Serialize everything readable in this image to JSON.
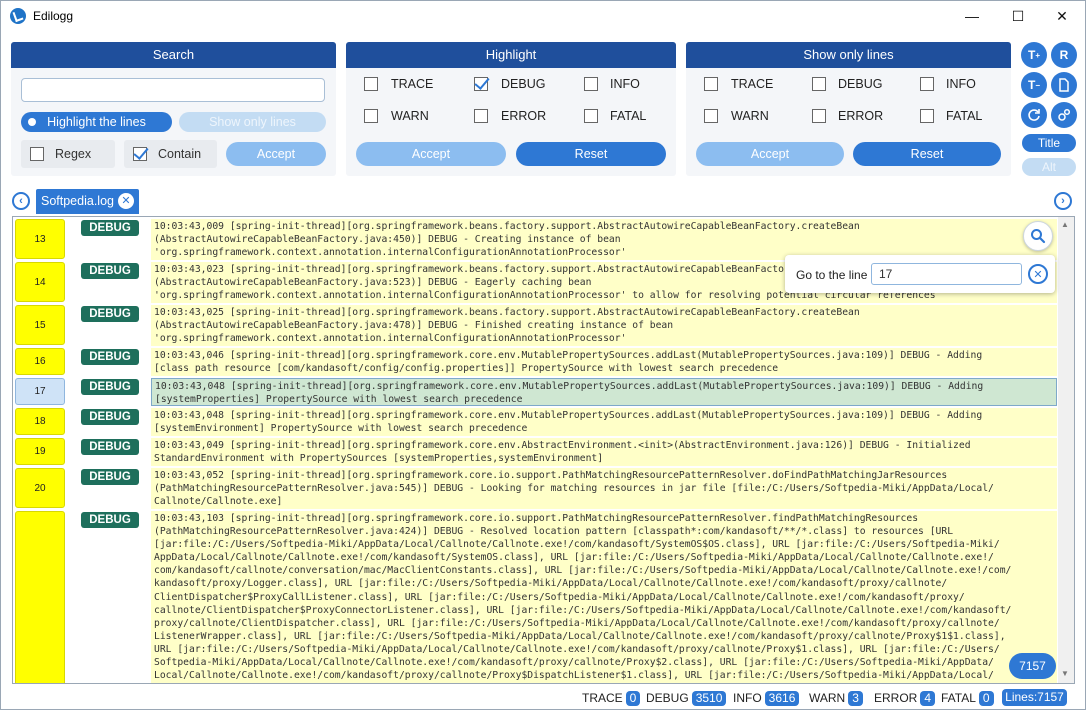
{
  "window": {
    "title": "Edilogg",
    "minimize_glyph": "—",
    "maximize_glyph": "☐",
    "close_glyph": "✕"
  },
  "search": {
    "header": "Search",
    "query": "",
    "highlight_label": "Highlight the lines",
    "show_only_label": "Show only lines",
    "regex_label": "Regex",
    "regex_checked": false,
    "contain_label": "Contain",
    "contain_checked": true,
    "accept_label": "Accept"
  },
  "highlight": {
    "header": "Highlight",
    "levels": [
      {
        "label": "TRACE",
        "checked": false
      },
      {
        "label": "DEBUG",
        "checked": true
      },
      {
        "label": "INFO",
        "checked": false
      },
      {
        "label": "WARN",
        "checked": false
      },
      {
        "label": "ERROR",
        "checked": false
      },
      {
        "label": "FATAL",
        "checked": false
      }
    ],
    "accept_label": "Accept",
    "reset_label": "Reset"
  },
  "show_only": {
    "header": "Show only lines",
    "levels": [
      {
        "label": "TRACE",
        "checked": false
      },
      {
        "label": "DEBUG",
        "checked": false
      },
      {
        "label": "INFO",
        "checked": false
      },
      {
        "label": "WARN",
        "checked": false
      },
      {
        "label": "ERROR",
        "checked": false
      },
      {
        "label": "FATAL",
        "checked": false
      }
    ],
    "accept_label": "Accept",
    "reset_label": "Reset"
  },
  "tools": {
    "r_label": "R",
    "title_label": "Title",
    "alt_label": "Alt"
  },
  "tabs": [
    {
      "label": "Softpedia.log",
      "active": true
    }
  ],
  "goto": {
    "label": "Go to the line",
    "value": "17"
  },
  "log_rows": [
    {
      "line": "13",
      "level": "DEBUG",
      "message": "10:03:43,009 [spring-init-thread][org.springframework.beans.factory.support.AbstractAutowireCapableBeanFactory.createBean\n(AbstractAutowireCapableBeanFactory.java:450)] DEBUG - Creating instance of bean\n'org.springframework.context.annotation.internalConfigurationAnnotationProcessor'"
    },
    {
      "line": "14",
      "level": "DEBUG",
      "message": "10:03:43,023 [spring-init-thread][org.springframework.beans.factory.support.AbstractAutowireCapableBeanFactory.createBean\n(AbstractAutowireCapableBeanFactory.java:523)] DEBUG - Eagerly caching bean\n'org.springframework.context.annotation.internalConfigurationAnnotationProcessor' to allow for resolving potential circular references"
    },
    {
      "line": "15",
      "level": "DEBUG",
      "message": "10:03:43,025 [spring-init-thread][org.springframework.beans.factory.support.AbstractAutowireCapableBeanFactory.createBean\n(AbstractAutowireCapableBeanFactory.java:478)] DEBUG - Finished creating instance of bean\n'org.springframework.context.annotation.internalConfigurationAnnotationProcessor'"
    },
    {
      "line": "16",
      "level": "DEBUG",
      "message": "10:03:43,046 [spring-init-thread][org.springframework.core.env.MutablePropertySources.addLast(MutablePropertySources.java:109)] DEBUG - Adding\n[class path resource [com/kandasoft/config/config.properties]] PropertySource with lowest search precedence"
    },
    {
      "line": "17",
      "level": "DEBUG",
      "message": "10:03:43,048 [spring-init-thread][org.springframework.core.env.MutablePropertySources.addLast(MutablePropertySources.java:109)] DEBUG - Adding\n[systemProperties] PropertySource with lowest search precedence"
    },
    {
      "line": "18",
      "level": "DEBUG",
      "message": "10:03:43,048 [spring-init-thread][org.springframework.core.env.MutablePropertySources.addLast(MutablePropertySources.java:109)] DEBUG - Adding\n[systemEnvironment] PropertySource with lowest search precedence"
    },
    {
      "line": "19",
      "level": "DEBUG",
      "message": "10:03:43,049 [spring-init-thread][org.springframework.core.env.AbstractEnvironment.<init>(AbstractEnvironment.java:126)] DEBUG - Initialized\nStandardEnvironment with PropertySources [systemProperties,systemEnvironment]"
    },
    {
      "line": "20",
      "level": "DEBUG",
      "message": "10:03:43,052 [spring-init-thread][org.springframework.core.io.support.PathMatchingResourcePatternResolver.doFindPathMatchingJarResources\n(PathMatchingResourcePatternResolver.java:545)] DEBUG - Looking for matching resources in jar file [file:/C:/Users/Softpedia-Miki/AppData/Local/\nCallnote/Callnote.exe]"
    },
    {
      "line": "",
      "level": "DEBUG",
      "message": "10:03:43,103 [spring-init-thread][org.springframework.core.io.support.PathMatchingResourcePatternResolver.findPathMatchingResources\n(PathMatchingResourcePatternResolver.java:424)] DEBUG - Resolved location pattern [classpath*:com/kandasoft/**/*.class] to resources [URL\n[jar:file:/C:/Users/Softpedia-Miki/AppData/Local/Callnote/Callnote.exe!/com/kandasoft/SystemOS$OS.class], URL [jar:file:/C:/Users/Softpedia-Miki/\nAppData/Local/Callnote/Callnote.exe!/com/kandasoft/SystemOS.class], URL [jar:file:/C:/Users/Softpedia-Miki/AppData/Local/Callnote/Callnote.exe!/\ncom/kandasoft/callnote/conversation/mac/MacClientConstants.class], URL [jar:file:/C:/Users/Softpedia-Miki/AppData/Local/Callnote/Callnote.exe!/com/\nkandasoft/proxy/Logger.class], URL [jar:file:/C:/Users/Softpedia-Miki/AppData/Local/Callnote/Callnote.exe!/com/kandasoft/proxy/callnote/\nClientDispatcher$ProxyCallListener.class], URL [jar:file:/C:/Users/Softpedia-Miki/AppData/Local/Callnote/Callnote.exe!/com/kandasoft/proxy/\ncallnote/ClientDispatcher$ProxyConnectorListener.class], URL [jar:file:/C:/Users/Softpedia-Miki/AppData/Local/Callnote/Callnote.exe!/com/kandasoft/\nproxy/callnote/ClientDispatcher.class], URL [jar:file:/C:/Users/Softpedia-Miki/AppData/Local/Callnote/Callnote.exe!/com/kandasoft/proxy/callnote/\nListenerWrapper.class], URL [jar:file:/C:/Users/Softpedia-Miki/AppData/Local/Callnote/Callnote.exe!/com/kandasoft/proxy/callnote/Proxy$1$1.class],\nURL [jar:file:/C:/Users/Softpedia-Miki/AppData/Local/Callnote/Callnote.exe!/com/kandasoft/proxy/callnote/Proxy$1.class], URL [jar:file:/C:/Users/\nSoftpedia-Miki/AppData/Local/Callnote/Callnote.exe!/com/kandasoft/proxy/callnote/Proxy$2.class], URL [jar:file:/C:/Users/Softpedia-Miki/AppData/\nLocal/Callnote/Callnote.exe!/com/kandasoft/proxy/callnote/Proxy$DispatchListener$1.class], URL [jar:file:/C:/Users/Softpedia-Miki/AppData/Local/"
    }
  ],
  "selected_line": "17",
  "line_count_bubble": "7157",
  "status": {
    "trace_label": "TRACE",
    "trace_count": "0",
    "debug_label": "DEBUG",
    "debug_count": "3510",
    "info_label": "INFO",
    "info_count": "3616",
    "warn_label": "WARN",
    "warn_count": "3",
    "error_label": "ERROR",
    "error_count": "4",
    "fatal_label": "FATAL",
    "fatal_count": "0",
    "lines_label": "Lines:7157"
  },
  "colors": {
    "header_blue": "#1f4f9c",
    "accent_blue": "#2e78d4",
    "line_number_yellow": "#ffff00",
    "message_yellow": "#ffffc8",
    "debug_badge": "#1e6f5c",
    "selected_row": "#cfe7d2"
  }
}
